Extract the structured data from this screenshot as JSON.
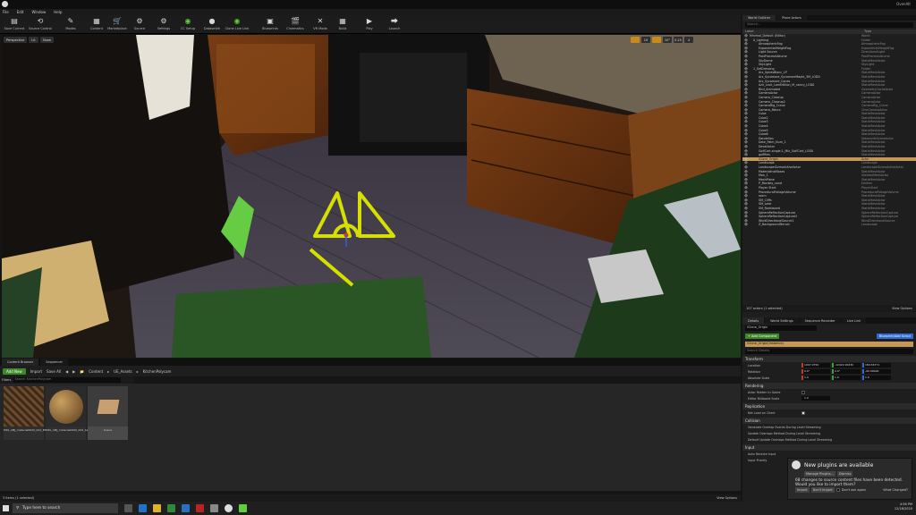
{
  "window": {
    "title": "OvenAlt"
  },
  "menu": [
    "File",
    "Edit",
    "Window",
    "Help"
  ],
  "toolbar": [
    {
      "label": "Save Current",
      "icon": "save-icon",
      "color": "#d8d8d8"
    },
    {
      "label": "Source Control",
      "icon": "source-control-icon",
      "color": "#d8d8d8"
    },
    {
      "label": "Modes",
      "icon": "modes-icon",
      "color": "#d8d8d8"
    },
    {
      "label": "Content",
      "icon": "content-icon",
      "color": "#d8d8d8"
    },
    {
      "label": "Marketplace",
      "icon": "marketplace-icon",
      "color": "#d8d8d8"
    },
    {
      "label": "Source",
      "icon": "source-icon",
      "color": "#d8d8d8"
    },
    {
      "label": "Settings",
      "icon": "settings-icon",
      "color": "#d8d8d8"
    },
    {
      "label": "CC Setup",
      "icon": "cc-setup-icon",
      "color": "#5fcf3a"
    },
    {
      "label": "Datasmith",
      "icon": "datasmith-icon",
      "color": "#d8d8d8"
    },
    {
      "label": "Clone Live Link",
      "icon": "live-link-icon",
      "color": "#5fcf3a"
    },
    {
      "label": "Blueprints",
      "icon": "blueprints-icon",
      "color": "#d8d8d8"
    },
    {
      "label": "Cinematics",
      "icon": "cinematics-icon",
      "color": "#d8d8d8"
    },
    {
      "label": "VR Mode",
      "icon": "vr-mode-icon",
      "color": "#d8d8d8"
    },
    {
      "label": "Build",
      "icon": "build-icon",
      "color": "#d8d8d8"
    },
    {
      "label": "Play",
      "icon": "play-icon",
      "color": "#d8d8d8"
    },
    {
      "label": "Launch",
      "icon": "launch-icon",
      "color": "#d8d8d8"
    }
  ],
  "viewport": {
    "perspective": "Perspective",
    "lit": "Lit",
    "show": "Show",
    "grid": "10",
    "rotate": "10°",
    "scale": "0.25",
    "cam": "4"
  },
  "content_browser": {
    "tabs": [
      "Content Browser",
      "Sequencer"
    ],
    "add_new": "Add New",
    "import": "Import",
    "save_all": "Save All",
    "path": [
      "Content",
      "UE_Assets",
      "KitchenPolycam"
    ],
    "filters": "Filters",
    "search_placeholder": "Search KitchenPolycam",
    "assets": [
      {
        "name": "MDL_OBJ_material0000_001_Bt_part_diffuse",
        "kind": "texture"
      },
      {
        "name": "MDL_OBJ_material0000_002_baked",
        "kind": "material"
      },
      {
        "name": "Scene",
        "kind": "scene"
      }
    ],
    "status": "3 items (1 selected)",
    "view_options": "View Options"
  },
  "outliner": {
    "tabs": [
      "World Outliner",
      "Place Actors"
    ],
    "search_placeholder": "Search...",
    "col_label": "Label",
    "col_type": "Type",
    "rows": [
      {
        "name": "Minimal_Default (Editor)",
        "type": "World"
      },
      {
        "name": "0_Lighting",
        "type": "Folder"
      },
      {
        "name": "AtmosphericFog",
        "type": "AtmosphericFog"
      },
      {
        "name": "ExponentialHeightFog",
        "type": "ExponentialHeightFog"
      },
      {
        "name": "Light Source",
        "type": "DirectionalLight"
      },
      {
        "name": "PostProcessVolume",
        "type": "PostProcessVolume"
      },
      {
        "name": "SkyDome",
        "type": "StaticMeshActor"
      },
      {
        "name": "SkyLight",
        "type": "SkyLight"
      },
      {
        "name": "1_SetDressing",
        "type": "Folder"
      },
      {
        "name": "Ars_SpiresBlanc_LP",
        "type": "StaticMeshActor"
      },
      {
        "name": "Ars_Sycamore_SycamoreMaple_3M_LOD0",
        "type": "StaticMeshActor"
      },
      {
        "name": "Ars_Sycamore_Cones",
        "type": "StaticMeshActor"
      },
      {
        "name": "Azir_Lock_LamEdition_M_nancy_LOD0",
        "type": "StaticMeshActor"
      },
      {
        "name": "Bird_Animated",
        "type": "GeometryCacheActor"
      },
      {
        "name": "CameraActor",
        "type": "CameraActor"
      },
      {
        "name": "Camera_Closeup",
        "type": "CameraActor"
      },
      {
        "name": "Camera_Closeup2",
        "type": "CameraActor"
      },
      {
        "name": "CameraRig_Crane",
        "type": "CameraRig_Crane"
      },
      {
        "name": "Camera_Macro",
        "type": "CineCameraActor"
      },
      {
        "name": "Cube",
        "type": "StaticMeshActor"
      },
      {
        "name": "Cube2",
        "type": "StaticMeshActor"
      },
      {
        "name": "Cube3",
        "type": "StaticMeshActor"
      },
      {
        "name": "Cube4",
        "type": "StaticMeshActor"
      },
      {
        "name": "Cube5",
        "type": "StaticMeshActor"
      },
      {
        "name": "Cube6",
        "type": "StaticMeshActor"
      },
      {
        "name": "Dandelion",
        "type": "DatasmithSceneActor"
      },
      {
        "name": "Date_Palm_Num_1",
        "type": "StaticMeshActor"
      },
      {
        "name": "DecalActor",
        "type": "StaticMeshActor"
      },
      {
        "name": "GolfCart-single-1_Mix_GolfCart_LOD0",
        "type": "StaticMeshActor"
      },
      {
        "name": "golfflies",
        "type": "StaticMeshActor"
      },
      {
        "name": "iClone_Origin",
        "type": "Actor",
        "selected": true
      },
      {
        "name": "Landscape",
        "type": "Landscape"
      },
      {
        "name": "LandscapeGizmoActiveActor",
        "type": "LandscapeGizmoActiveActor"
      },
      {
        "name": "MaterialInstBases",
        "type": "StaticMeshActor"
      },
      {
        "name": "Man_1",
        "type": "SkeletalMeshActor"
      },
      {
        "name": "MeshPlane",
        "type": "StaticMeshActor"
      },
      {
        "name": "P_Monkey_sand",
        "type": "Emitter"
      },
      {
        "name": "Player Start",
        "type": "PlayerStart"
      },
      {
        "name": "ProceduralFoliageVolume",
        "type": "ProceduralFoliageVolume"
      },
      {
        "name": "room",
        "type": "StaticMeshActor"
      },
      {
        "name": "SM_Cliffs",
        "type": "StaticMeshActor"
      },
      {
        "name": "SM_Lake",
        "type": "StaticMeshActor"
      },
      {
        "name": "SM_Rockboard",
        "type": "StaticMeshActor"
      },
      {
        "name": "SphereReflectionCapture",
        "type": "SphereReflectionCapture"
      },
      {
        "name": "SphereReflectionCapture2",
        "type": "SphereReflectionCapture"
      },
      {
        "name": "WindDirectionalSource1",
        "type": "WindDirectionalSource"
      },
      {
        "name": "Z_BackgroundTerrain",
        "type": "Landscape"
      }
    ],
    "footer_count": "107 actors (1 selected)",
    "view_options": "View Options"
  },
  "details": {
    "tabs": [
      "Details",
      "World Settings",
      "Sequence Recorder",
      "Live Link"
    ],
    "actor_name": "iClone_Origin",
    "add_component": "+ Add Component",
    "blueprint": "Blueprint/Add Script",
    "instance": "iClone_Origin(Instance)",
    "search_placeholder": "Search Details",
    "sec_transform": "Transform",
    "location_label": "Location",
    "location": [
      "1007.0750",
      "-12422.00230",
      "180.56771"
    ],
    "rotation_label": "Rotation",
    "rotation": [
      "0.0°",
      "0.0°",
      "-90.00000"
    ],
    "scale_label": "Absolute Scale",
    "scale": [
      "1.0",
      "1.0",
      "1.0"
    ],
    "sec_rendering": "Rendering",
    "hidden_label": "Actor Hidden In Game",
    "billboard_label": "Editor Billboard Scale",
    "billboard_value": "1.0",
    "sec_replication": "Replication",
    "netload_label": "Net Load on Client",
    "sec_collision": "Collision",
    "gen_overlap": "Generate Overlap Events During Level Streaming",
    "update_overlap": "Update Overlaps Method During Level Streaming",
    "default_update": "Default Update Overlaps Method During Level Streaming",
    "sec_input": "Input",
    "auto_receive": "Auto Receive Input",
    "input_priority": "Input Priority"
  },
  "notification": {
    "title": "New plugins are available",
    "manage": "Manage Plugins...",
    "dismiss": "Dismiss",
    "body": "68 changes to source content files have been detected. Would you like to import them?",
    "import": "Import",
    "dont_import": "Don't Import",
    "dont_ask": "Don't ask again",
    "what_changed": "What Changed?"
  },
  "taskbar": {
    "search": "Type here to search",
    "time": "4:56 PM",
    "date": "12/18/2020"
  }
}
